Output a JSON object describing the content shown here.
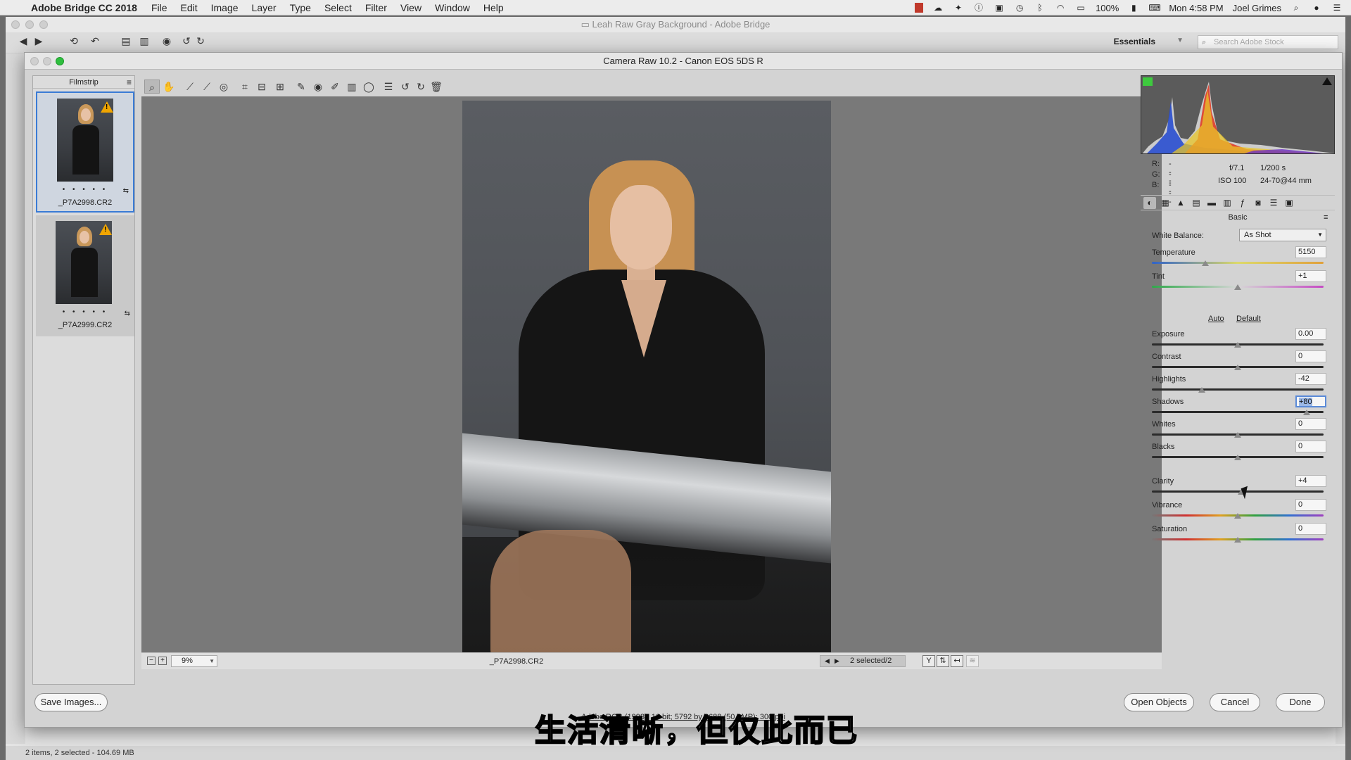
{
  "menubar": {
    "app_name": "Adobe Bridge CC 2018",
    "items": [
      "File",
      "Edit",
      "Image",
      "Layer",
      "Type",
      "Select",
      "Filter",
      "View",
      "Window",
      "Help"
    ],
    "battery": "100%",
    "clock": "Mon 4:58 PM",
    "user": "Joel Grimes"
  },
  "bridge": {
    "title": "Leah Raw Gray Background - Adobe Bridge",
    "workspace": "Essentials",
    "search_placeholder": "Search Adobe Stock",
    "status": "2 items, 2 selected - 104.69 MB"
  },
  "acr": {
    "title": "Camera Raw 10.2  -  Canon EOS 5DS R",
    "filmstrip_title": "Filmstrip",
    "thumbnails": [
      {
        "name": "_P7A2998.CR2",
        "selected": true
      },
      {
        "name": "_P7A2999.CR2",
        "selected": false
      }
    ],
    "preview_footer": {
      "zoom": "9%",
      "file_name": "_P7A2998.CR2",
      "selection": "2 selected/2"
    },
    "info": {
      "r_label": "R:",
      "r_value": "---",
      "g_label": "G:",
      "g_value": "---",
      "b_label": "B:",
      "b_value": "---",
      "aperture": "f/7.1",
      "shutter": "1/200 s",
      "iso": "ISO 100",
      "lens": "24-70@44 mm"
    },
    "panel_title": "Basic",
    "white_balance": {
      "label": "White Balance:",
      "value": "As Shot"
    },
    "auto_label": "Auto",
    "default_label": "Default",
    "sliders": {
      "temperature": {
        "label": "Temperature",
        "value": "5150",
        "position": 0.31
      },
      "tint": {
        "label": "Tint",
        "value": "+1",
        "position": 0.5
      },
      "exposure": {
        "label": "Exposure",
        "value": "0.00",
        "position": 0.5
      },
      "contrast": {
        "label": "Contrast",
        "value": "0",
        "position": 0.5
      },
      "highlights": {
        "label": "Highlights",
        "value": "-42",
        "position": 0.29
      },
      "shadows": {
        "label": "Shadows",
        "value": "+80",
        "position": 0.9
      },
      "whites": {
        "label": "Whites",
        "value": "0",
        "position": 0.5
      },
      "blacks": {
        "label": "Blacks",
        "value": "0",
        "position": 0.5
      },
      "clarity": {
        "label": "Clarity",
        "value": "+4",
        "position": 0.52
      },
      "vibrance": {
        "label": "Vibrance",
        "value": "0",
        "position": 0.5
      },
      "saturation": {
        "label": "Saturation",
        "value": "0",
        "position": 0.5
      }
    },
    "buttons": {
      "save": "Save Images...",
      "open": "Open Objects",
      "cancel": "Cancel",
      "done": "Done"
    },
    "workflow_options": "Adobe RGB (1998); 16 bit; 5792 by 8688 (50.3MP); 300 ppi"
  },
  "subtitle": "生活清晰，但仅此而已",
  "colors": {
    "accent": "#3a7bd5",
    "warning": "#f0a500",
    "clip_shadow": "#3eca3e"
  }
}
